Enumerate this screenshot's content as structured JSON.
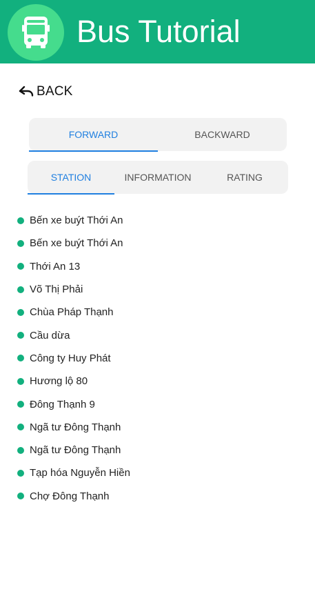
{
  "app": {
    "title": "Bus Tutorial",
    "logo_icon": "bus-icon",
    "brand_color": "#12b07e",
    "logo_circle_color": "#45dc8d"
  },
  "back": {
    "icon": "undo-arrow-icon",
    "label": "BACK"
  },
  "direction_tabs": [
    {
      "label": "FORWARD",
      "active": true
    },
    {
      "label": "BACKWARD",
      "active": false
    }
  ],
  "section_tabs": [
    {
      "label": "STATION",
      "active": true
    },
    {
      "label": "INFORMATION",
      "active": false
    },
    {
      "label": "RATING",
      "active": false
    }
  ],
  "accent_color": "#1f7fe0",
  "stations": [
    "Bến xe buýt Thới An",
    "Bến xe buýt Thới An",
    "Thới An 13",
    "Võ Thị Phải",
    "Chùa Pháp Thạnh",
    "Cầu dừa",
    "Công ty Huy Phát",
    "Hương lộ 80",
    "Đông Thạnh 9",
    "Ngã tư Đông Thạnh",
    "Ngã tư Đông Thạnh",
    "Tạp hóa Nguyễn Hiền",
    "Chợ Đông Thạnh"
  ]
}
